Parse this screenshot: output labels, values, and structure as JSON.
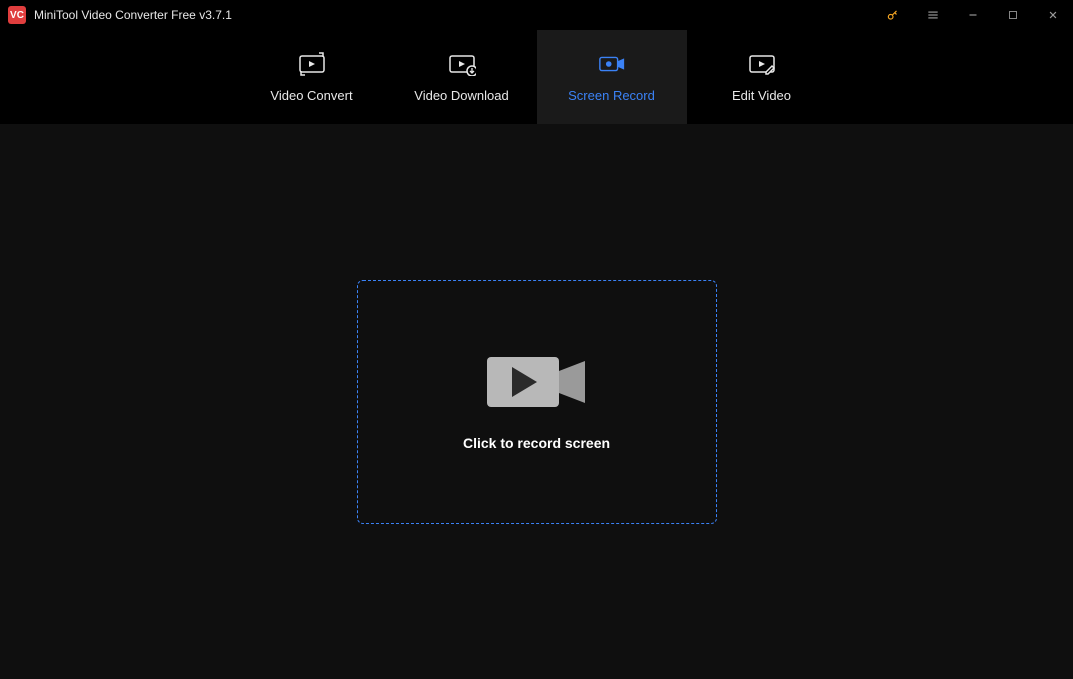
{
  "app": {
    "logo_text": "VC",
    "title": "MiniTool Video Converter Free v3.7.1"
  },
  "tabs": {
    "convert": "Video Convert",
    "download": "Video Download",
    "record": "Screen Record",
    "edit": "Edit Video"
  },
  "main": {
    "record_label": "Click to record screen"
  },
  "colors": {
    "accent": "#3b82f6",
    "upgrade_key": "#f5a623"
  }
}
